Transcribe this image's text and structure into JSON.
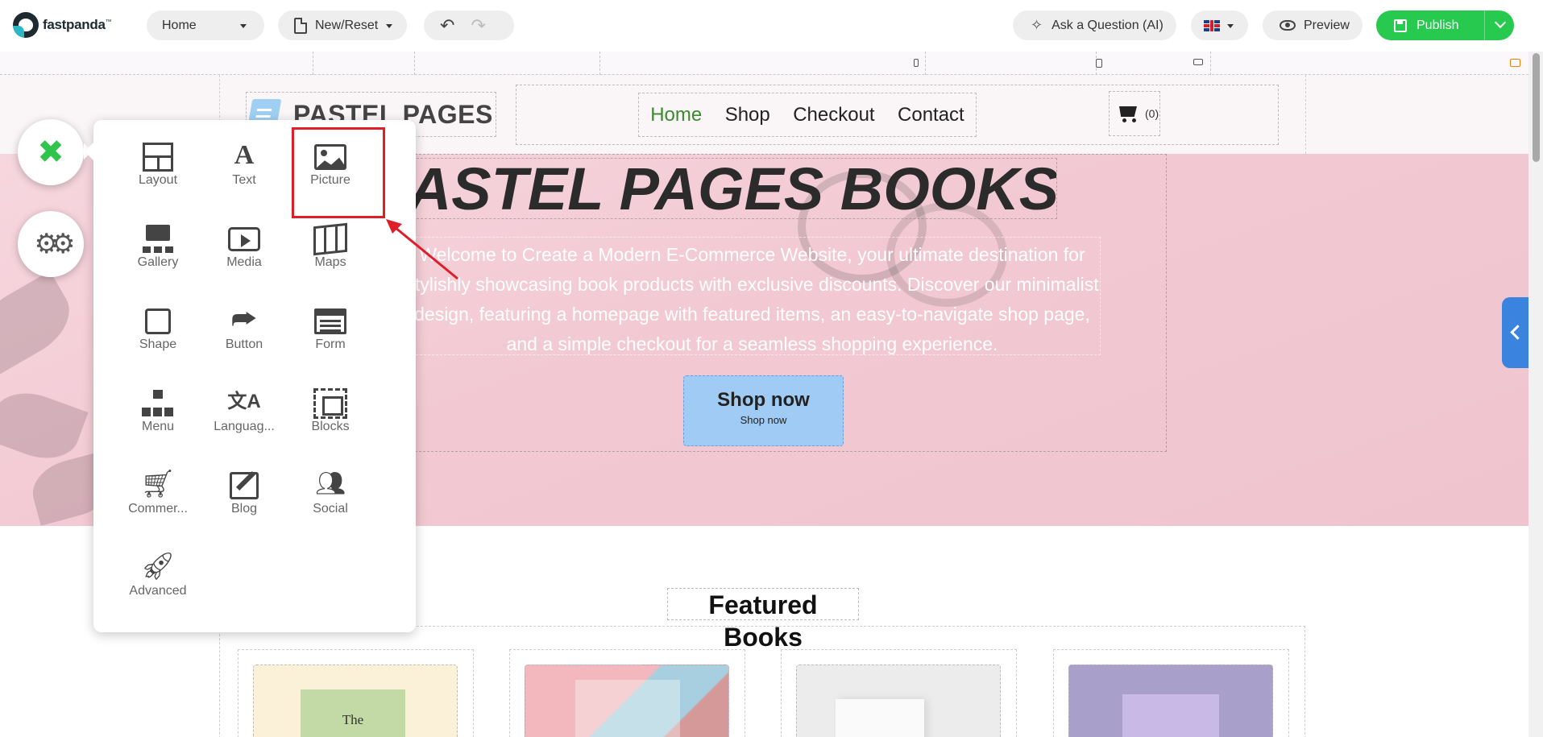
{
  "toolbar": {
    "logo_text": "fastpanda",
    "logo_tm": "™",
    "page_select": "Home",
    "new_reset": "New/Reset",
    "ask": "Ask a Question (AI)",
    "preview": "Preview",
    "publish": "Publish"
  },
  "site": {
    "logo_text": "PASTEL PAGES",
    "nav": [
      "Home",
      "Shop",
      "Checkout",
      "Contact"
    ],
    "cart_count": "(0)"
  },
  "hero": {
    "title": "PASTEL PAGES BOOKSHOP",
    "description": "Welcome to Create a Modern E-Commerce Website, your ultimate destination for stylishly showcasing book products with exclusive discounts. Discover our minimalist design, featuring a homepage with featured items, an easy-to-navigate shop page, and a simple checkout for a seamless shopping experience.",
    "button_main": "Shop now",
    "button_sub": "Shop now"
  },
  "featured": {
    "title": "Featured Books"
  },
  "panel": {
    "tools": [
      {
        "label": "Layout",
        "icon": "layout-icon"
      },
      {
        "label": "Text",
        "icon": "text-icon"
      },
      {
        "label": "Picture",
        "icon": "picture-icon"
      },
      {
        "label": "Gallery",
        "icon": "gallery-icon"
      },
      {
        "label": "Media",
        "icon": "media-icon"
      },
      {
        "label": "Maps",
        "icon": "maps-icon"
      },
      {
        "label": "Shape",
        "icon": "shape-icon"
      },
      {
        "label": "Button",
        "icon": "share-button-icon"
      },
      {
        "label": "Form",
        "icon": "form-icon"
      },
      {
        "label": "Menu",
        "icon": "sitemap-icon"
      },
      {
        "label": "Languag...",
        "icon": "language-icon"
      },
      {
        "label": "Blocks",
        "icon": "blocks-icon"
      },
      {
        "label": "Commer...",
        "icon": "cart-icon"
      },
      {
        "label": "Blog",
        "icon": "blog-icon"
      },
      {
        "label": "Social",
        "icon": "users-icon"
      },
      {
        "label": "Advanced",
        "icon": "rocket-icon"
      }
    ]
  },
  "colors": {
    "accent_green": "#27c94f",
    "highlight_red": "#e01e2a",
    "hero_pink": "#f2c9d3",
    "side_tab_blue": "#3a84e0"
  }
}
